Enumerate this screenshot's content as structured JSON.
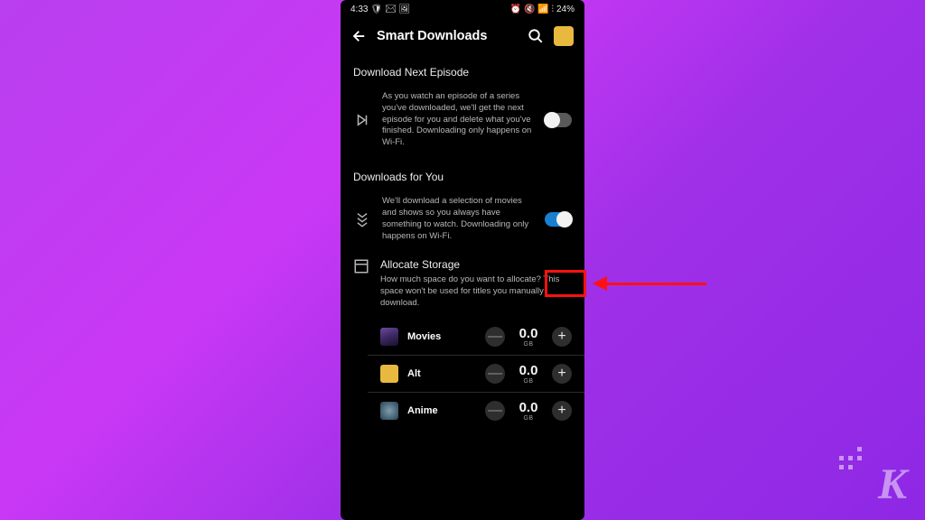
{
  "status": {
    "time": "4:33",
    "icons_left": "🛡 ✉ 🖼",
    "icons_right": "⏰ 🔇 📶 ⫶",
    "battery": "24%"
  },
  "header": {
    "title": "Smart Downloads"
  },
  "section1": {
    "title": "Download Next Episode",
    "desc": "As you watch an episode of a series you've downloaded, we'll get the next episode for you and delete what you've finished. Downloading only happens on Wi-Fi."
  },
  "section2": {
    "title": "Downloads for You",
    "desc": "We'll download a selection of movies and shows so you always have something to watch. Downloading only happens on Wi-Fi."
  },
  "alloc": {
    "title": "Allocate Storage",
    "desc": "How much space do you want to allocate? This space won't be used for titles you manually download."
  },
  "storage": {
    "rows": [
      {
        "name": "Movies",
        "value": "0.0",
        "unit": "GB"
      },
      {
        "name": "Alt",
        "value": "0.0",
        "unit": "GB"
      },
      {
        "name": "Anime",
        "value": "0.0",
        "unit": "GB"
      }
    ]
  },
  "glyphs": {
    "minus": "—",
    "plus": "+"
  }
}
